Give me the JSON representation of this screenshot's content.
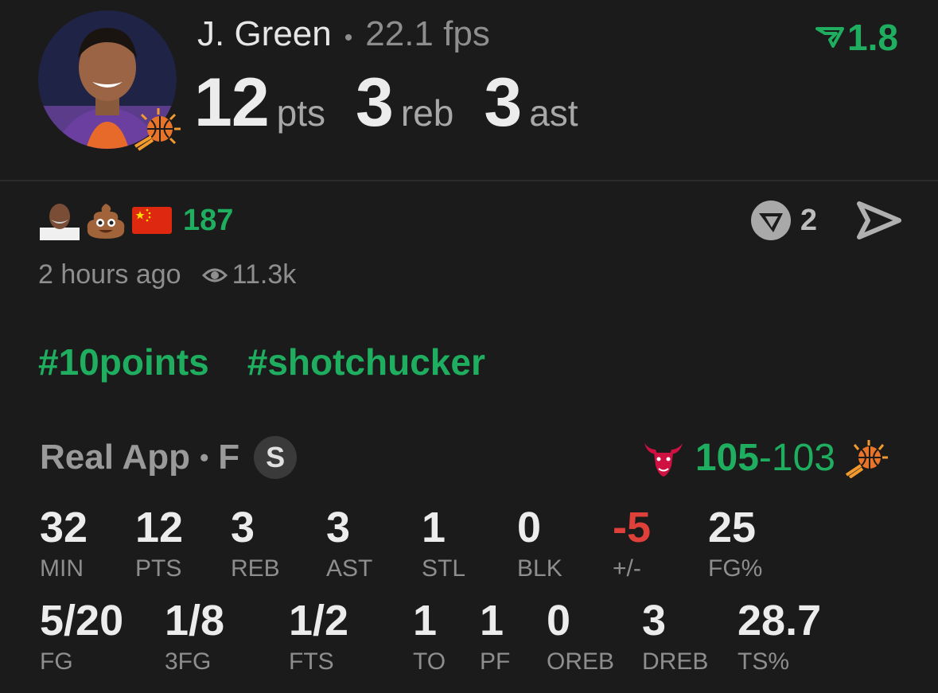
{
  "player": {
    "name": "J. Green",
    "fps": "22.1 fps",
    "rating": "1.8",
    "headline": [
      {
        "value": "12",
        "unit": "pts"
      },
      {
        "value": "3",
        "unit": "reb"
      },
      {
        "value": "3",
        "unit": "ast"
      }
    ]
  },
  "post": {
    "reactions": [
      "man-face-avatar",
      "poop-emoji",
      "china-flag-emoji"
    ],
    "reaction_count": "187",
    "comment_count": "2",
    "time_ago": "2 hours ago",
    "views": "11.3k",
    "tags": [
      "#10points",
      "#shotchucker"
    ]
  },
  "game": {
    "source": "Real App",
    "position": "F",
    "starter_badge": "S",
    "score_home": "105",
    "score_sep": "-",
    "score_away": "103",
    "home_team_icon": "bulls-logo",
    "away_team_icon": "suns-logo"
  },
  "stats_row1": [
    {
      "value": "32",
      "label": "MIN"
    },
    {
      "value": "12",
      "label": "PTS"
    },
    {
      "value": "3",
      "label": "REB"
    },
    {
      "value": "3",
      "label": "AST"
    },
    {
      "value": "1",
      "label": "STL"
    },
    {
      "value": "0",
      "label": "BLK"
    },
    {
      "value": "-5",
      "label": "+/-"
    },
    {
      "value": "25",
      "label": "FG%"
    }
  ],
  "stats_row2": [
    {
      "value": "5/20",
      "label": "FG"
    },
    {
      "value": "1/8",
      "label": "3FG"
    },
    {
      "value": "1/2",
      "label": "FTS"
    },
    {
      "value": "1",
      "label": "TO"
    },
    {
      "value": "1",
      "label": "PF"
    },
    {
      "value": "0",
      "label": "OREB"
    },
    {
      "value": "3",
      "label": "DREB"
    },
    {
      "value": "28.7",
      "label": "TS%"
    }
  ],
  "colors": {
    "background": "#1b1b1b",
    "accent_green": "#1fae5f",
    "negative_red": "#e0403a",
    "muted": "#8e8e8e"
  }
}
